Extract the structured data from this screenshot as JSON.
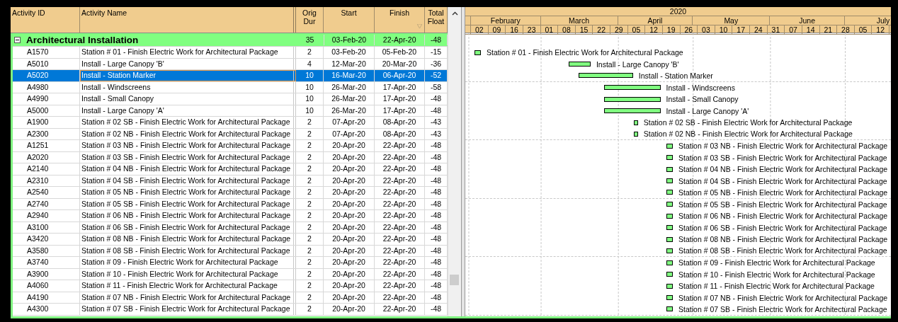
{
  "columns": [
    {
      "label": "Activity ID",
      "filter": false
    },
    {
      "label": "Activity Name",
      "filter": false
    },
    {
      "label": "Orig Dur",
      "filter": false
    },
    {
      "label": "Start",
      "filter": false
    },
    {
      "label": "Finish",
      "filter": true
    },
    {
      "label": "Total Float",
      "filter": false
    }
  ],
  "group": {
    "name": "Architectural Installation",
    "expanded": true,
    "orig_dur": "35",
    "start": "03-Feb-20",
    "finish": "22-Apr-20",
    "total_float": "-48"
  },
  "rows": [
    {
      "id": "A1570",
      "name": "Station # 01 - Finish Electric Work for Architectural Package",
      "orig_dur": "2",
      "start": "03-Feb-20",
      "finish": "05-Feb-20",
      "total_float": "-15",
      "selected": false,
      "bar_label": "Station # 01 - Finish Electric Work for Architectural Package"
    },
    {
      "id": "A5010",
      "name": "Install - Large Canopy 'B'",
      "orig_dur": "4",
      "start": "12-Mar-20",
      "finish": "20-Mar-20",
      "total_float": "-36",
      "selected": false,
      "bar_label": "Install - Large Canopy 'B'"
    },
    {
      "id": "A5020",
      "name": "Install - Station Marker",
      "orig_dur": "10",
      "start": "16-Mar-20",
      "finish": "06-Apr-20",
      "total_float": "-52",
      "selected": true,
      "bar_label": "Install - Station Marker"
    },
    {
      "id": "A4980",
      "name": "Install - Windscreens",
      "orig_dur": "10",
      "start": "26-Mar-20",
      "finish": "17-Apr-20",
      "total_float": "-58",
      "selected": false,
      "bar_label": "Install - Windscreens"
    },
    {
      "id": "A4990",
      "name": "Install - Small Canopy",
      "orig_dur": "10",
      "start": "26-Mar-20",
      "finish": "17-Apr-20",
      "total_float": "-48",
      "selected": false,
      "bar_label": "Install - Small Canopy"
    },
    {
      "id": "A5000",
      "name": "Install - Large Canopy 'A'",
      "orig_dur": "10",
      "start": "26-Mar-20",
      "finish": "17-Apr-20",
      "total_float": "-48",
      "selected": false,
      "bar_label": "Install - Large Canopy 'A'"
    },
    {
      "id": "A1900",
      "name": "Station # 02 SB - Finish Electric Work for Architectural Package",
      "orig_dur": "2",
      "start": "07-Apr-20",
      "finish": "08-Apr-20",
      "total_float": "-43",
      "selected": false,
      "bar_label": "Station # 02 SB - Finish Electric Work for Architectural Package"
    },
    {
      "id": "A2300",
      "name": "Station # 02 NB - Finish Electric Work for Architectural Package",
      "orig_dur": "2",
      "start": "07-Apr-20",
      "finish": "08-Apr-20",
      "total_float": "-43",
      "selected": false,
      "bar_label": "Station # 02 NB - Finish Electric Work for Architectural Package"
    },
    {
      "id": "A1251",
      "name": "Station # 03 NB - Finish Electric Work for Architectural Package",
      "orig_dur": "2",
      "start": "20-Apr-20",
      "finish": "22-Apr-20",
      "total_float": "-48",
      "selected": false,
      "bar_label": "Station # 03 NB - Finish Electric Work for Architectural Package"
    },
    {
      "id": "A2020",
      "name": "Station # 03 SB - Finish Electric Work for Architectural Package",
      "orig_dur": "2",
      "start": "20-Apr-20",
      "finish": "22-Apr-20",
      "total_float": "-48",
      "selected": false,
      "bar_label": "Station # 03 SB - Finish Electric Work for Architectural Package"
    },
    {
      "id": "A2140",
      "name": "Station # 04 NB - Finish Electric Work for Architectural Package",
      "orig_dur": "2",
      "start": "20-Apr-20",
      "finish": "22-Apr-20",
      "total_float": "-48",
      "selected": false,
      "bar_label": "Station # 04 NB - Finish Electric Work for Architectural Package"
    },
    {
      "id": "A2310",
      "name": "Station # 04 SB - Finish Electric Work for Architectural Package",
      "orig_dur": "2",
      "start": "20-Apr-20",
      "finish": "22-Apr-20",
      "total_float": "-48",
      "selected": false,
      "bar_label": "Station # 04 SB - Finish Electric Work for Architectural Package"
    },
    {
      "id": "A2540",
      "name": "Station # 05 NB - Finish Electric Work for Architectural Package",
      "orig_dur": "2",
      "start": "20-Apr-20",
      "finish": "22-Apr-20",
      "total_float": "-48",
      "selected": false,
      "bar_label": "Station # 05 NB - Finish Electric Work for Architectural Package"
    },
    {
      "id": "A2740",
      "name": "Station # 05 SB - Finish Electric Work for Architectural Package",
      "orig_dur": "2",
      "start": "20-Apr-20",
      "finish": "22-Apr-20",
      "total_float": "-48",
      "selected": false,
      "bar_label": "Station # 05 SB - Finish Electric Work for Architectural Package"
    },
    {
      "id": "A2940",
      "name": "Station # 06 NB - Finish Electric Work for Architectural Package",
      "orig_dur": "2",
      "start": "20-Apr-20",
      "finish": "22-Apr-20",
      "total_float": "-48",
      "selected": false,
      "bar_label": "Station # 06 NB - Finish Electric Work for Architectural Package"
    },
    {
      "id": "A3100",
      "name": "Station # 06 SB - Finish Electric Work for Architectural Package",
      "orig_dur": "2",
      "start": "20-Apr-20",
      "finish": "22-Apr-20",
      "total_float": "-48",
      "selected": false,
      "bar_label": "Station # 06 SB - Finish Electric Work for Architectural Package"
    },
    {
      "id": "A3420",
      "name": "Station # 08 NB - Finish Electric Work for Architectural Package",
      "orig_dur": "2",
      "start": "20-Apr-20",
      "finish": "22-Apr-20",
      "total_float": "-48",
      "selected": false,
      "bar_label": "Station # 08 NB - Finish Electric Work for Architectural Package"
    },
    {
      "id": "A3580",
      "name": "Station # 08 SB - Finish Electric Work for Architectural Package",
      "orig_dur": "2",
      "start": "20-Apr-20",
      "finish": "22-Apr-20",
      "total_float": "-48",
      "selected": false,
      "bar_label": "Station # 08 SB - Finish Electric Work for Architectural Package"
    },
    {
      "id": "A3740",
      "name": "Station # 09 - Finish Electric Work for Architectural Package",
      "orig_dur": "2",
      "start": "20-Apr-20",
      "finish": "22-Apr-20",
      "total_float": "-48",
      "selected": false,
      "bar_label": "Station # 09 - Finish Electric Work for Architectural Package"
    },
    {
      "id": "A3900",
      "name": "Station # 10 - Finish Electric Work for Architectural Package",
      "orig_dur": "2",
      "start": "20-Apr-20",
      "finish": "22-Apr-20",
      "total_float": "-48",
      "selected": false,
      "bar_label": "Station # 10 - Finish Electric Work for Architectural Package"
    },
    {
      "id": "A4060",
      "name": "Station # 11 - Finish Electric Work for Architectural Package",
      "orig_dur": "2",
      "start": "20-Apr-20",
      "finish": "22-Apr-20",
      "total_float": "-48",
      "selected": false,
      "bar_label": "Station # 11 - Finish Electric Work for Architectural Package"
    },
    {
      "id": "A4190",
      "name": "Station # 07 NB - Finish Electric Work for Architectural Package",
      "orig_dur": "2",
      "start": "20-Apr-20",
      "finish": "22-Apr-20",
      "total_float": "-48",
      "selected": false,
      "bar_label": "Station # 07 NB - Finish Electric Work for Architectural Package"
    },
    {
      "id": "A4300",
      "name": "Station # 07 SB - Finish Electric Work for Architectural Package",
      "orig_dur": "2",
      "start": "20-Apr-20",
      "finish": "22-Apr-20",
      "total_float": "-48",
      "selected": false,
      "bar_label": "Station # 07 SB - Finish Electric Work for Architectural Package"
    }
  ],
  "gantt": {
    "year": "2020",
    "months": [
      "February",
      "March",
      "April",
      "May",
      "June",
      "July"
    ],
    "weeks": [
      "02",
      "09",
      "16",
      "23",
      "01",
      "08",
      "15",
      "22",
      "29",
      "05",
      "12",
      "19",
      "26",
      "03",
      "10",
      "17",
      "24",
      "31",
      "07",
      "14",
      "21",
      "28",
      "05",
      "12"
    ]
  }
}
